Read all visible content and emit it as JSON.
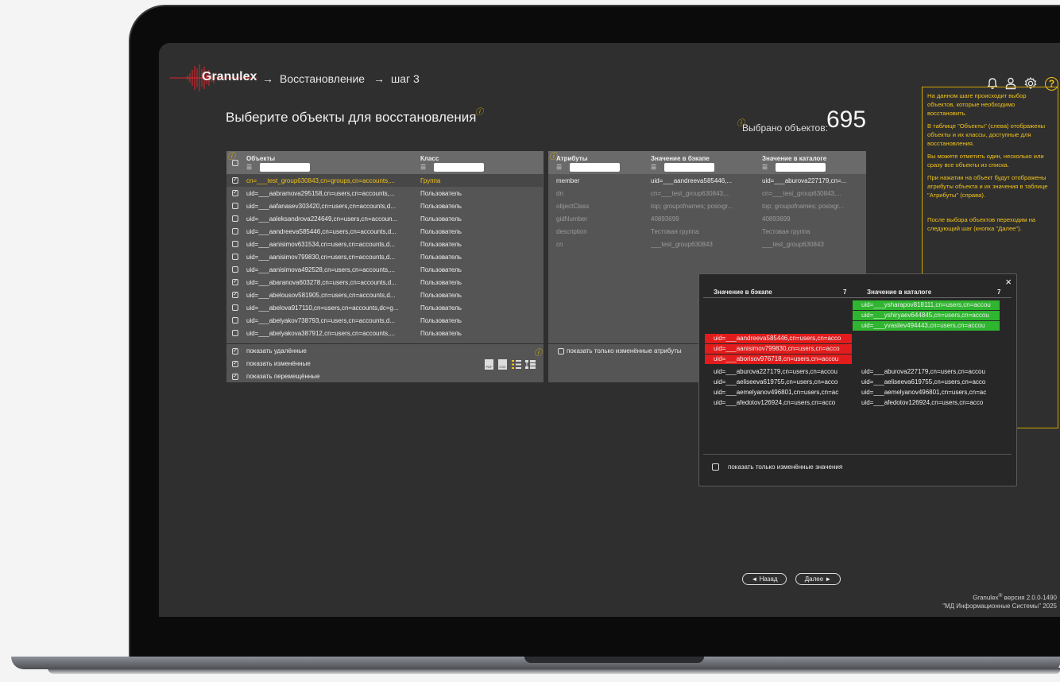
{
  "header": {
    "brand": "Granulex",
    "breadcrumb": [
      "Восстановление",
      "шаг 3"
    ],
    "arrow": "→",
    "icons": [
      "bell-icon",
      "user-icon",
      "gear-icon",
      "help-icon"
    ],
    "help_glyph": "?"
  },
  "page": {
    "title": "Выберите объекты для восстановления",
    "info_glyph": "ⓘ",
    "selected_label": "Выбрано объектов:",
    "selected_count": "695"
  },
  "objects": {
    "col_objects": "Объекты",
    "col_class": "Класс",
    "filter_glyph": "☰",
    "rows": [
      {
        "name": "cn=___test_group630843,cn=groups,cn=accounts,...",
        "cls": "Группа",
        "checked": true
      },
      {
        "name": "uid=___aabramova295158,cn=users,cn=accounts,...",
        "cls": "Пользователь",
        "checked": true
      },
      {
        "name": "uid=___aafanasev303420,cn=users,cn=accounts,d...",
        "cls": "Пользователь",
        "checked": false
      },
      {
        "name": "uid=___aaleksandrova224649,cn=users,cn=accoun...",
        "cls": "Пользователь",
        "checked": false
      },
      {
        "name": "uid=___aandreeva585446,cn=users,cn=accounts,d...",
        "cls": "Пользователь",
        "checked": false
      },
      {
        "name": "uid=___aanisimov631534,cn=users,cn=accounts,d...",
        "cls": "Пользователь",
        "checked": false
      },
      {
        "name": "uid=___aanisimov799830,cn=users,cn=accounts,d...",
        "cls": "Пользователь",
        "checked": false
      },
      {
        "name": "uid=___aanisimova492528,cn=users,cn=accounts,...",
        "cls": "Пользователь",
        "checked": false
      },
      {
        "name": "uid=___abaranova603278,cn=users,cn=accounts,d...",
        "cls": "Пользователь",
        "checked": true
      },
      {
        "name": "uid=___abelousov581905,cn=users,cn=accounts,d...",
        "cls": "Пользователь",
        "checked": true
      },
      {
        "name": "uid=___abelova917110,cn=users,cn=accounts,dc=g...",
        "cls": "Пользователь",
        "checked": false
      },
      {
        "name": "uid=___abelyakov738793,cn=users,cn=accounts,d...",
        "cls": "Пользователь",
        "checked": false
      },
      {
        "name": "uid=___abelyakova387912,cn=users,cn=accounts,...",
        "cls": "Пользователь",
        "checked": false
      }
    ],
    "options": [
      "показать удалённые",
      "показать изменённые",
      "показать перемещённые"
    ],
    "exports": [
      "PDF",
      "CSV"
    ]
  },
  "attributes": {
    "col_attr": "Атрибуты",
    "col_backup": "Значение в бэкапе",
    "col_catalog": "Значение в каталоге",
    "rows": [
      {
        "attr": "member",
        "backup": "uid=___aandreeva585446,...",
        "catalog": "uid=___aburova227179,cn=...",
        "bright": true
      },
      {
        "attr": "dn",
        "backup": "cn=___test_group630843,...",
        "catalog": "cn=___test_group630843,...",
        "bright": false
      },
      {
        "attr": "objectClass",
        "backup": "top; groupofnames; posixgr...",
        "catalog": "top; groupofnames; posixgr...",
        "bright": false
      },
      {
        "attr": "gidNumber",
        "backup": "40893699",
        "catalog": "40893699",
        "bright": false
      },
      {
        "attr": "description",
        "backup": "Тестовая группа",
        "catalog": "Тестовая группа",
        "bright": false
      },
      {
        "attr": "cn",
        "backup": "___test_group630843",
        "catalog": "___test_group630843",
        "bright": false
      }
    ],
    "changed_only": "показать только изменённые атрибуты"
  },
  "help_box": [
    "На данном шаге происходит выбор объектов, которые необходимо восстановить.",
    "В таблице \"Объекты\" (слева) отображены объекты и их классы, доступные для восстановления.",
    "Вы можете отметить один, несколько или сразу все объекты из списка.",
    "При нажатии на объект будут отображены атрибуты объекта и их значения в таблице \"Атрибуты\" (справа).",
    "После выбора объектов переходим на следующий шаг (кнопка \"Далее\")."
  ],
  "popup": {
    "close": "×",
    "col_backup": "Значение в бэкапе",
    "col_backup_count": "7",
    "col_catalog": "Значение в каталоге",
    "col_catalog_count": "7",
    "green": [
      "uid=___ysharapov818111,cn=users,cn=accou",
      "uid=___yshiryaev644845,cn=users,cn=accou",
      "uid=___yvasilev494443,cn=users,cn=accou"
    ],
    "red": [
      "uid=___aandreeva585446,cn=users,cn=acco",
      "uid=___aanisimov799830,cn=users,cn=acco",
      "uid=___aborisov976718,cn=users,cn=accou"
    ],
    "left_plain": [
      "uid=___aburova227179,cn=users,cn=accou",
      "uid=___aeliseeva619755,cn=users,cn=acco",
      "uid=___aemelyanov496801,cn=users,cn=ac",
      "uid=___afedotov126924,cn=users,cn=acco"
    ],
    "right_plain": [
      "uid=___aburova227179,cn=users,cn=accou",
      "uid=___aeliseeva619755,cn=users,cn=acco",
      "uid=___aemelyanov496801,cn=users,cn=ac",
      "uid=___afedotov126924,cn=users,cn=acco"
    ],
    "changed_only": "показать только изменённые значения"
  },
  "nav": {
    "back": "◄ Назад",
    "next": "Далее ►"
  },
  "footer": {
    "line1_a": "Granulex",
    "line1_reg": "®",
    "line1_b": " версия 2.0.0-1490",
    "line2": "\"МД Информационные Системы\" 2025"
  },
  "colors": {
    "accent": "#f2c319",
    "changed_red": "#e21c1c",
    "new_green": "#2fb52f"
  }
}
